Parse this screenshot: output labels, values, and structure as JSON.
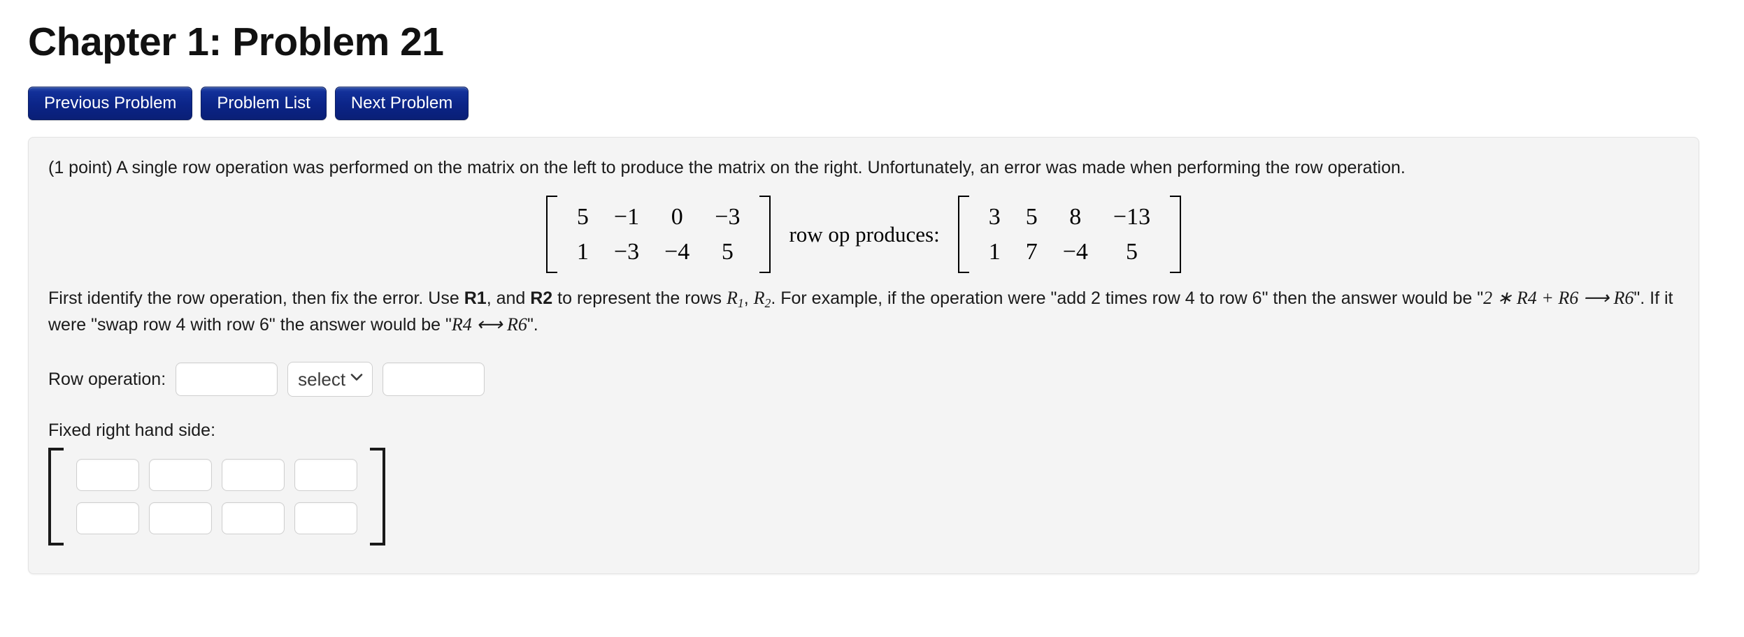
{
  "page": {
    "title": "Chapter 1: Problem 21"
  },
  "nav_buttons": [
    {
      "label": "Previous Problem",
      "name": "previous-problem-button"
    },
    {
      "label": "Problem List",
      "name": "problem-list-button"
    },
    {
      "label": "Next Problem",
      "name": "next-problem-button"
    }
  ],
  "problem": {
    "points_text": "(1 point)",
    "statement": "A single row operation was performed on the matrix on the left to produce the matrix on the right. Unfortunately, an error was made when performing the row operation.",
    "full_statement": "(1 point) A single row operation was performed on the matrix on the left to produce the matrix on the right. Unfortunately, an error was made when performing the row operation.",
    "row_op_label": "row op produces:",
    "left_matrix": {
      "rows": 2,
      "cols": 4,
      "values": [
        [
          "5",
          "−1",
          "0",
          "−3"
        ],
        [
          "1",
          "−3",
          "−4",
          "5"
        ]
      ]
    },
    "right_matrix": {
      "rows": 2,
      "cols": 4,
      "values": [
        [
          "3",
          "5",
          "8",
          "−13"
        ],
        [
          "1",
          "7",
          "−4",
          "5"
        ]
      ]
    },
    "instructions": {
      "part1": "First identify the row operation, then fix the error. Use ",
      "r1_bold": "R1",
      "part2": ", and ",
      "r2_bold": "R2",
      "part3": " to represent the rows ",
      "row1_math": "R",
      "row1_sub": "1",
      "comma": ", ",
      "row2_math": "R",
      "row2_sub": "2",
      "part4": ". For example, if the operation were \"add 2 times row 4 to row 6\" then the answer would be \"",
      "example_math": "2 ∗ R4 + R6 ⟶ R6",
      "part5": "\". If it were \"swap row 4 with row 6\" the answer would be \"",
      "swap_math": "R4 ⟷ R6",
      "part6": "\"."
    }
  },
  "form": {
    "row_operation_label": "Row operation:",
    "row_op_input_1": {
      "value": "",
      "placeholder": ""
    },
    "row_op_select": {
      "selected": "select",
      "options": [
        "select"
      ]
    },
    "row_op_input_2": {
      "value": "",
      "placeholder": ""
    },
    "fixed_rhs_label": "Fixed right hand side:",
    "answer_matrix": {
      "rows": 2,
      "cols": 4,
      "values": [
        [
          "",
          "",
          "",
          ""
        ],
        [
          "",
          "",
          "",
          ""
        ]
      ]
    }
  },
  "colors": {
    "button_blue": "#0b2487",
    "panel_background": "#f4f4f4",
    "panel_border": "#e3e3e3",
    "page_background": "#ffffff",
    "input_border": "#cfcfcf"
  }
}
